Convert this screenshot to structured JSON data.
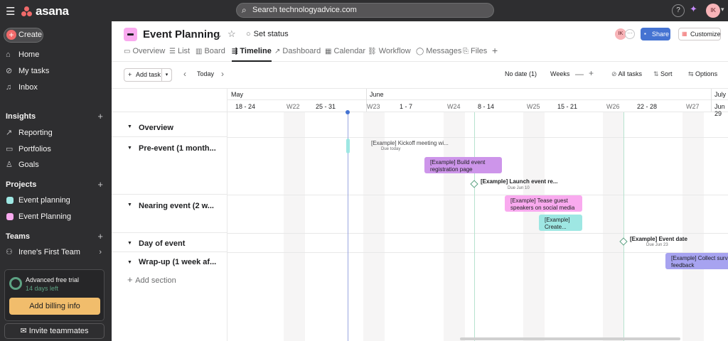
{
  "topbar": {
    "brand": "asana",
    "search_placeholder": "Search technologyadvice.com",
    "help": "?",
    "user_initials": "IK"
  },
  "sidebar": {
    "create": "Create",
    "nav": [
      {
        "label": "Home",
        "icon": "home-icon"
      },
      {
        "label": "My tasks",
        "icon": "check-circle-icon"
      },
      {
        "label": "Inbox",
        "icon": "bell-icon"
      }
    ],
    "insights_title": "Insights",
    "insights": [
      {
        "label": "Reporting",
        "icon": "trend-icon"
      },
      {
        "label": "Portfolios",
        "icon": "folder-icon"
      },
      {
        "label": "Goals",
        "icon": "person-icon"
      }
    ],
    "projects_title": "Projects",
    "projects": [
      {
        "label": "Event planning",
        "color": "#9ee7e3"
      },
      {
        "label": "Event Planning",
        "color": "#f9aaef"
      }
    ],
    "teams_title": "Teams",
    "team": "Irene's First Team",
    "trial_title": "Advanced free trial",
    "trial_days": "14 days left",
    "billing": "Add billing info",
    "invite": "Invite teammates"
  },
  "header": {
    "title": "Event Planning",
    "set_status": "Set status",
    "member_initials": "IK",
    "share": "Share",
    "customize": "Customize",
    "tabs": [
      {
        "label": "Overview",
        "icon": "▭"
      },
      {
        "label": "List",
        "icon": "☰"
      },
      {
        "label": "Board",
        "icon": "▥"
      },
      {
        "label": "Timeline",
        "icon": "⇶"
      },
      {
        "label": "Dashboard",
        "icon": "↗"
      },
      {
        "label": "Calendar",
        "icon": "▦"
      },
      {
        "label": "Workflow",
        "icon": "⛓"
      },
      {
        "label": "Messages",
        "icon": "◯"
      },
      {
        "label": "Files",
        "icon": "⎘"
      }
    ],
    "active_tab": "Timeline"
  },
  "toolbar": {
    "add_task": "Add task",
    "today": "Today",
    "no_date": "No date (1)",
    "zoom": "Weeks",
    "all_tasks": "All tasks",
    "sort": "Sort",
    "options": "Options"
  },
  "sections": [
    "Overview",
    "Pre-event (1 month...",
    "Nearing event (2 w...",
    "Day of event",
    "Wrap-up (1 week af..."
  ],
  "add_section": "Add section",
  "timeline": {
    "months": [
      "May",
      "June",
      "July"
    ],
    "weeks": [
      "18 - 24",
      "W22",
      "25 - 31",
      "W23",
      "1 - 7",
      "W24",
      "8 - 14",
      "W25",
      "15 - 21",
      "W26",
      "22 - 28",
      "W27",
      "Jun 29"
    ],
    "tasks": {
      "kickoff": {
        "label": "[Example] Kickoff meeting wi...",
        "due": "Due today",
        "color": "#9ee7e3"
      },
      "registration": {
        "line1": "[Example] Build event",
        "line2": "registration page",
        "color": "#cd95ea"
      },
      "launch": {
        "label": "[Example] Launch event re...",
        "due": "Due Jun 10"
      },
      "tease": {
        "line1": "[Example] Tease guest",
        "line2": "speakers on social media",
        "color": "#f9aaef"
      },
      "create": {
        "line1": "[Example]",
        "line2": "Create...",
        "color": "#9ee7e3"
      },
      "eventdate": {
        "label": "[Example] Event date",
        "due": "Due Jun 23"
      },
      "survey": {
        "line1": "[Example] Collect surv",
        "line2": "feedback",
        "color": "#a7a3f0"
      }
    }
  }
}
